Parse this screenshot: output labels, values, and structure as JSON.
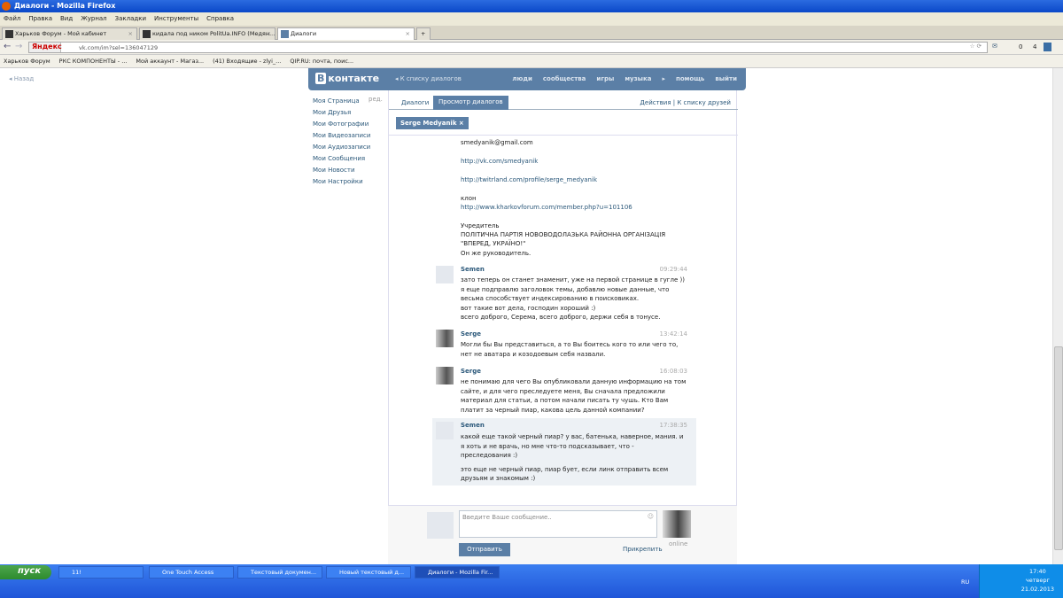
{
  "window": {
    "title": "Диалоги - Mozilla Firefox"
  },
  "menu": [
    "Файл",
    "Правка",
    "Вид",
    "Журнал",
    "Закладки",
    "Инструменты",
    "Справка"
  ],
  "tabs": [
    {
      "label": "Харьков Форум - Мой кабинет"
    },
    {
      "label": "кидала под ником PolitUa.INFO (Медян..."
    },
    {
      "label": "Диалоги"
    }
  ],
  "nav": {
    "url": "vk.com/im?sel=136047129",
    "yandex": "Яндекс",
    "mail_count": "0",
    "rss_count": "4"
  },
  "bookmarks": [
    "Харьков Форум",
    "РКС КОМПОНЕНТЫ - ...",
    "Мой аккаунт - Магаз...",
    "(41) Входящие - zlyi_...",
    "QIP.RU: почта, поис..."
  ],
  "page": {
    "back": "Назад"
  },
  "vk": {
    "logo": "контакте",
    "logo_b": "В",
    "to_list": "◂ К списку диалогов",
    "topnav": [
      "люди",
      "сообщества",
      "игры",
      "музыка",
      "▸",
      "помощь",
      "выйти"
    ],
    "leftmenu": [
      "Моя Страница",
      "Мои Друзья",
      "Мои Фотографии",
      "Мои Видеозаписи",
      "Мои Аудиозаписи",
      "Мои Сообщения",
      "Мои Новости",
      "Мои Настройки"
    ],
    "edit": "ред.",
    "tab_dialogs": "Диалоги",
    "tab_view": "Просмотр диалогов",
    "actions": "Действия  |  К списку друзей",
    "chip": "Serge Medyanik ×"
  },
  "prev_lines": [
    "smedyanik@gmail.com",
    "http://vk.com/smedyanik",
    "http://twitrland.com/profile/serge_medyanik",
    "клон",
    "http://www.kharkovforum.com/member.php?u=101106",
    "Учредитель",
    "ПОЛІТИЧНА ПАРТІЯ НОВОВОДОЛАЗЬКА РАЙОННА ОРГАНІЗАЦІЯ",
    "\"ВПЕРЕД, УКРАЇНО!\"",
    "Он же руководитель."
  ],
  "messages": [
    {
      "author": "Semen",
      "time": "09:29:44",
      "lines": [
        "зато теперь он станет знаменит, уже на первой странице в гугле ))",
        "я еще подправлю заголовок темы, добавлю новые данные, что",
        "весьма способствует индексированию в поисковиках.",
        "вот такие вот дела, господин хороший :)",
        "всего доброго, Серема, всего доброго, держи себя в тонусе."
      ]
    },
    {
      "author": "Serge",
      "time": "13:42:14",
      "lines": [
        "Могли бы Вы представиться, а то Вы боитесь кого то или чего то,",
        "нет не аватара и козодоевым себя назвали."
      ]
    },
    {
      "author": "Serge",
      "time": "16:08:03",
      "lines": [
        "не понимаю для чего Вы опубликовали данную информацию на том",
        "сайте, и для чего преследуете меня, Вы сначала предложили",
        "материал для статьи, а потом начали писать ту чушь. Кто Вам",
        "платит за черный пиар, какова цель данной компании?"
      ]
    },
    {
      "author": "Semen",
      "time": "17:38:35",
      "lines": [
        "какой еще такой черный пиар? у вас, батенька, наверное, мания. и",
        "я хоть и не врачь, но мне что-то подсказывает, что -",
        "преследования :)",
        "",
        "это еще не черный пиар, пиар бует, если линк отправить всем",
        "друзьям и знакомым :)"
      ]
    }
  ],
  "compose": {
    "placeholder": "Введите Ваше сообщение..",
    "send": "Отправить",
    "attach": "Прикрепить",
    "online": "online"
  },
  "taskbar": {
    "start": "пуск",
    "items": [
      "11!",
      "One Touch Access",
      "Текстовый докумен...",
      "Новый текстовый д...",
      "Диалоги - Mozilla Fir..."
    ],
    "lang": "RU",
    "time": "17:40",
    "day": "четверг",
    "date": "21.02.2013"
  }
}
